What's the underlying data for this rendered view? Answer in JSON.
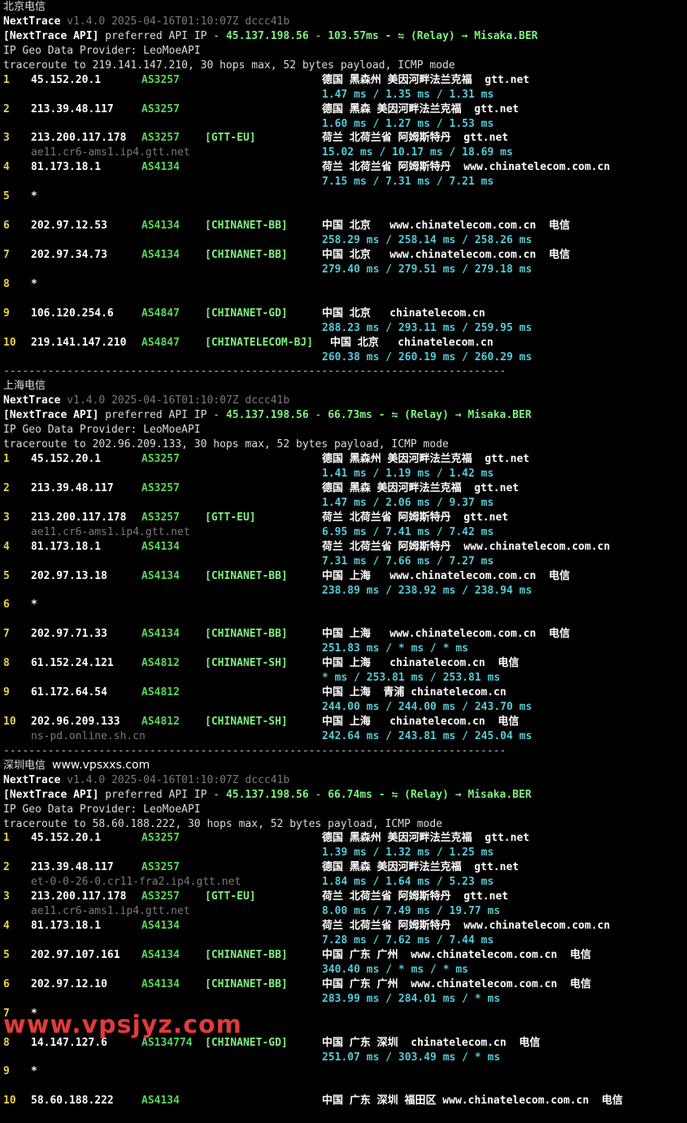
{
  "common": {
    "app_name": "NextTrace",
    "version": "v1.4.0 2025-04-16T01:10:07Z dccc41b",
    "api_label": "[NextTrace API]",
    "api_text": " preferred API IP - ",
    "api_ip": "45.137.198.56",
    "dash": " - ",
    "relay": " ⇋ (Relay) → Misaka.BER",
    "geo_provider": "IP Geo Data Provider: LeoMoeAPI",
    "separator": "-------------------------------------------------------------------------------",
    "watermark": "www.vpsjyz.com"
  },
  "sections": [
    {
      "title": "北京电信",
      "site": "",
      "latency": "103.57ms",
      "traceroute": "traceroute to 219.141.147.210, 30 hops max, 52 bytes payload, ICMP mode",
      "hops": [
        {
          "n": "1",
          "ip": "45.152.20.1",
          "as": "AS3257",
          "tag": "",
          "rdns": "",
          "geo": "德国 黑森州 美因河畔法兰克福  gtt.net",
          "rtt": "1.47 ms / 1.35 ms / 1.31 ms"
        },
        {
          "n": "2",
          "ip": "213.39.48.117",
          "as": "AS3257",
          "tag": "",
          "rdns": "",
          "geo": "德国 黑森 美因河畔法兰克福  gtt.net",
          "rtt": "1.60 ms / 1.27 ms / 1.53 ms"
        },
        {
          "n": "3",
          "ip": "213.200.117.178",
          "as": "AS3257",
          "tag": "[GTT-EU]",
          "rdns": "ae11.cr6-ams1.ip4.gtt.net",
          "geo": "荷兰 北荷兰省 阿姆斯特丹  gtt.net",
          "rtt": "15.02 ms / 10.17 ms / 18.69 ms"
        },
        {
          "n": "4",
          "ip": "81.173.18.1",
          "as": "AS4134",
          "tag": "",
          "rdns": "",
          "geo": "荷兰 北荷兰省 阿姆斯特丹  www.chinatelecom.com.cn",
          "rtt": "7.15 ms / 7.31 ms / 7.21 ms"
        },
        {
          "n": "5",
          "ip": "*",
          "as": "",
          "tag": "",
          "rdns": "",
          "geo": "",
          "rtt": ""
        },
        {
          "n": "6",
          "ip": "202.97.12.53",
          "as": "AS4134",
          "tag": "[CHINANET-BB]",
          "rdns": "",
          "geo": "中国 北京   www.chinatelecom.com.cn  电信",
          "rtt": "258.29 ms / 258.14 ms / 258.26 ms"
        },
        {
          "n": "7",
          "ip": "202.97.34.73",
          "as": "AS4134",
          "tag": "[CHINANET-BB]",
          "rdns": "",
          "geo": "中国 北京   www.chinatelecom.com.cn  电信",
          "rtt": "279.40 ms / 279.51 ms / 279.18 ms"
        },
        {
          "n": "8",
          "ip": "*",
          "as": "",
          "tag": "",
          "rdns": "",
          "geo": "",
          "rtt": ""
        },
        {
          "n": "9",
          "ip": "106.120.254.6",
          "as": "AS4847",
          "tag": "[CHINANET-GD]",
          "rdns": "",
          "geo": "中国 北京   chinatelecom.cn",
          "rtt": "288.23 ms / 293.11 ms / 259.95 ms"
        },
        {
          "n": "10",
          "ip": "219.141.147.210",
          "as": "AS4847",
          "tag": "[CHINATELECOM-BJ]",
          "rdns": "",
          "geo": "中国 北京   chinatelecom.cn",
          "rtt": "260.38 ms / 260.19 ms / 260.29 ms"
        }
      ]
    },
    {
      "title": "上海电信",
      "site": "",
      "latency": "66.73ms",
      "traceroute": "traceroute to 202.96.209.133, 30 hops max, 52 bytes payload, ICMP mode",
      "hops": [
        {
          "n": "1",
          "ip": "45.152.20.1",
          "as": "AS3257",
          "tag": "",
          "rdns": "",
          "geo": "德国 黑森州 美因河畔法兰克福  gtt.net",
          "rtt": "1.41 ms / 1.19 ms / 1.42 ms"
        },
        {
          "n": "2",
          "ip": "213.39.48.117",
          "as": "AS3257",
          "tag": "",
          "rdns": "",
          "geo": "德国 黑森 美因河畔法兰克福  gtt.net",
          "rtt": "1.47 ms / 2.06 ms / 9.37 ms"
        },
        {
          "n": "3",
          "ip": "213.200.117.178",
          "as": "AS3257",
          "tag": "[GTT-EU]",
          "rdns": "ae11.cr6-ams1.ip4.gtt.net",
          "geo": "荷兰 北荷兰省 阿姆斯特丹  gtt.net",
          "rtt": "6.95 ms / 7.41 ms / 7.42 ms"
        },
        {
          "n": "4",
          "ip": "81.173.18.1",
          "as": "AS4134",
          "tag": "",
          "rdns": "",
          "geo": "荷兰 北荷兰省 阿姆斯特丹  www.chinatelecom.com.cn",
          "rtt": "7.31 ms / 7.66 ms / 7.27 ms"
        },
        {
          "n": "5",
          "ip": "202.97.13.18",
          "as": "AS4134",
          "tag": "[CHINANET-BB]",
          "rdns": "",
          "geo": "中国 上海   www.chinatelecom.com.cn  电信",
          "rtt": "238.89 ms / 238.92 ms / 238.94 ms"
        },
        {
          "n": "6",
          "ip": "*",
          "as": "",
          "tag": "",
          "rdns": "",
          "geo": "",
          "rtt": ""
        },
        {
          "n": "7",
          "ip": "202.97.71.33",
          "as": "AS4134",
          "tag": "[CHINANET-BB]",
          "rdns": "",
          "geo": "中国 上海   www.chinatelecom.com.cn  电信",
          "rtt": "251.83 ms / * ms / * ms"
        },
        {
          "n": "8",
          "ip": "61.152.24.121",
          "as": "AS4812",
          "tag": "[CHINANET-SH]",
          "rdns": "",
          "geo": "中国 上海   chinatelecom.cn  电信",
          "rtt": "* ms / 253.81 ms / 253.81 ms"
        },
        {
          "n": "9",
          "ip": "61.172.64.54",
          "as": "AS4812",
          "tag": "",
          "rdns": "",
          "geo": "中国 上海  青浦 chinatelecom.cn",
          "rtt": "244.00 ms / 244.00 ms / 243.70 ms"
        },
        {
          "n": "10",
          "ip": "202.96.209.133",
          "as": "AS4812",
          "tag": "[CHINANET-SH]",
          "rdns": "ns-pd.online.sh.cn",
          "geo": "中国 上海   chinatelecom.cn  电信",
          "rtt": "242.64 ms / 243.81 ms / 245.04 ms"
        }
      ]
    },
    {
      "title": "深圳电信",
      "site": "www.vpsxxs.com",
      "latency": "66.74ms",
      "traceroute": "traceroute to 58.60.188.222, 30 hops max, 52 bytes payload, ICMP mode",
      "hops": [
        {
          "n": "1",
          "ip": "45.152.20.1",
          "as": "AS3257",
          "tag": "",
          "rdns": "",
          "geo": "德国 黑森州 美因河畔法兰克福  gtt.net",
          "rtt": "1.39 ms / 1.32 ms / 1.25 ms"
        },
        {
          "n": "2",
          "ip": "213.39.48.117",
          "as": "AS3257",
          "tag": "",
          "rdns": "et-0-0-26-0.cr11-fra2.ip4.gtt.net",
          "geo": "德国 黑森 美因河畔法兰克福  gtt.net",
          "rtt": "1.84 ms / 1.64 ms / 5.23 ms"
        },
        {
          "n": "3",
          "ip": "213.200.117.178",
          "as": "AS3257",
          "tag": "[GTT-EU]",
          "rdns": "ae11.cr6-ams1.ip4.gtt.net",
          "geo": "荷兰 北荷兰省 阿姆斯特丹  gtt.net",
          "rtt": "8.00 ms / 7.49 ms / 19.77 ms"
        },
        {
          "n": "4",
          "ip": "81.173.18.1",
          "as": "AS4134",
          "tag": "",
          "rdns": "",
          "geo": "荷兰 北荷兰省 阿姆斯特丹  www.chinatelecom.com.cn",
          "rtt": "7.28 ms / 7.62 ms / 7.44 ms"
        },
        {
          "n": "5",
          "ip": "202.97.107.161",
          "as": "AS4134",
          "tag": "[CHINANET-BB]",
          "rdns": "",
          "geo": "中国 广东 广州  www.chinatelecom.com.cn  电信",
          "rtt": "340.40 ms / * ms / * ms"
        },
        {
          "n": "6",
          "ip": "202.97.12.10",
          "as": "AS4134",
          "tag": "[CHINANET-BB]",
          "rdns": "",
          "geo": "中国 广东 广州  www.chinatelecom.com.cn  电信",
          "rtt": "283.99 ms / 284.01 ms / * ms"
        },
        {
          "n": "7",
          "ip": "*",
          "as": "",
          "tag": "",
          "rdns": "",
          "geo": "",
          "rtt": ""
        },
        {
          "n": "8",
          "ip": "14.147.127.6",
          "as": "AS134774",
          "tag": "[CHINANET-GD]",
          "rdns": "",
          "geo": "中国 广东 深圳  chinatelecom.cn  电信",
          "rtt": "251.07 ms / 303.49 ms / * ms"
        },
        {
          "n": "9",
          "ip": "*",
          "as": "",
          "tag": "",
          "rdns": "",
          "geo": "",
          "rtt": ""
        },
        {
          "n": "10",
          "ip": "58.60.188.222",
          "as": "AS4134",
          "tag": "",
          "rdns": "",
          "geo": "中国 广东 深圳 福田区 www.chinatelecom.com.cn  电信",
          "rtt": ""
        }
      ]
    }
  ]
}
